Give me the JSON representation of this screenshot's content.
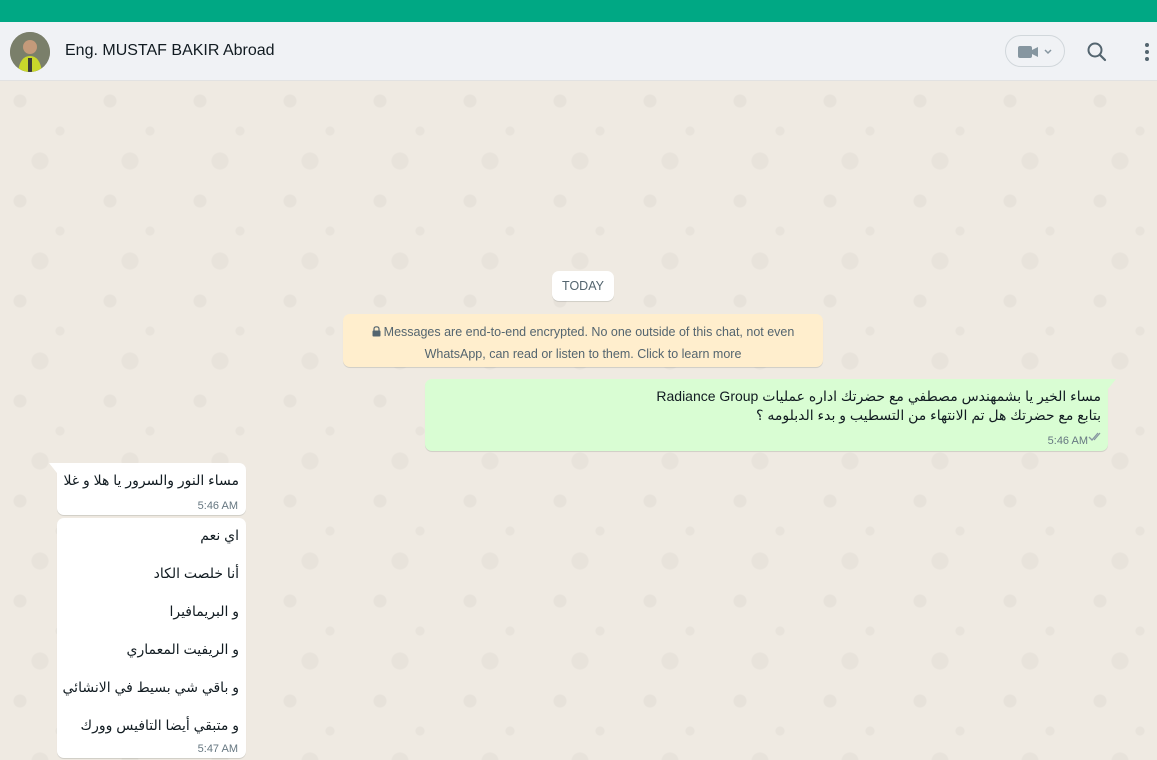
{
  "header": {
    "contact_name": "Eng. MUSTAF BAKIR Abroad",
    "icons": [
      "video-call-icon",
      "chevron-down-icon",
      "search-icon",
      "menu-icon"
    ]
  },
  "colors": {
    "top_strip": "#00a884",
    "outgoing_bubble": "#d9fdd3",
    "incoming_bubble": "#ffffff",
    "encryption_notice": "#ffeecd",
    "chat_background": "#efeae2"
  },
  "chat": {
    "date_divider": "TODAY",
    "encryption_notice": "Messages are end-to-end encrypted. No one outside of this chat, not even WhatsApp, can read or listen to them. Click to learn more",
    "messages": [
      {
        "direction": "outgoing",
        "lines": [
          "مساء الخير يا بشمهندس مصطفي مع  حضرتك اداره عمليات Radiance Group",
          "بتابع مع حضرتك هل تم الانتهاء من التسطيب و بدء الدبلومه ؟"
        ],
        "time": "5:46 AM",
        "status": "read"
      },
      {
        "direction": "incoming",
        "lines": [
          "مساء النور والسرور يا هلا و غلا"
        ],
        "time": "5:46 AM"
      },
      {
        "direction": "incoming",
        "lines": [
          "اي نعم",
          "أنا خلصت الكاد",
          "و البريمافيرا",
          "و الريفيت المعماري",
          "و باقي شي بسيط في الانشائي",
          "و متبقي أيضا التافيس وورك"
        ],
        "time": "5:47 AM"
      }
    ]
  }
}
